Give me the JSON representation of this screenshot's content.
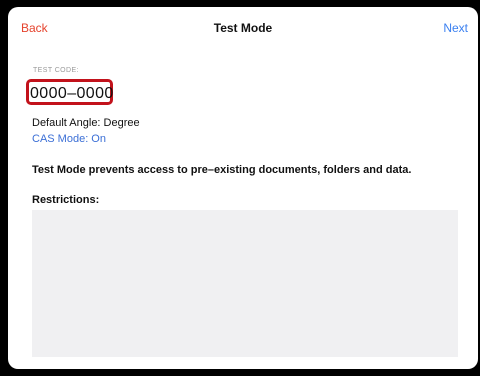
{
  "header": {
    "back_label": "Back",
    "title": "Test Mode",
    "next_label": "Next"
  },
  "test_code": {
    "label": "TEST CODE:",
    "value": "0000–0000"
  },
  "settings": {
    "default_angle": "Default Angle: Degree",
    "cas_mode": "CAS Mode: On"
  },
  "info_text": "Test Mode prevents access to pre–existing documents, folders and data.",
  "restrictions": {
    "heading": "Restrictions:"
  },
  "colors": {
    "back": "#e5432d",
    "next": "#3b80f0",
    "highlight_box": "#c2121b",
    "cas_link": "#3b6fd6"
  }
}
